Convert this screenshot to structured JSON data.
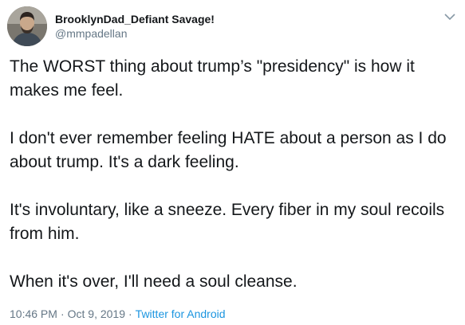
{
  "author": {
    "display_name": "BrooklynDad_Defiant Savage!",
    "screen_name": "@mmpadellan",
    "avatar_icon": "profile-photo"
  },
  "tweet": {
    "paragraphs": [
      "The WORST thing about trump’s \"presidency\" is how it makes me feel.",
      "I don't ever remember feeling HATE about a person as I do about trump. It's a dark feeling.",
      "It's involuntary, like a sneeze. Every fiber in my soul recoils from him.",
      "When it's over, I'll need a soul cleanse."
    ]
  },
  "meta": {
    "time": "10:46 PM",
    "separator": "·",
    "date": "Oct 9, 2019",
    "source": "Twitter for Android"
  },
  "colors": {
    "text": "#14171a",
    "secondary": "#657786",
    "link": "#1b95e0"
  },
  "menu_icon": "chevron-down-icon"
}
